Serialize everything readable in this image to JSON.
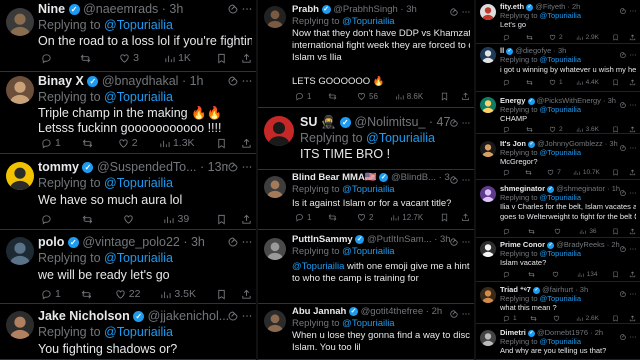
{
  "columns": [
    {
      "tweets": [
        {
          "name": "Nine",
          "handle": "@naeemrads",
          "time": "3h",
          "reply_prefix": "Replying to",
          "reply_to": "@Topuriailia",
          "text": [
            "On the road to a loss lol if you're fighting Islam"
          ],
          "replies": "",
          "reposts": "",
          "likes": "3",
          "views": "1K"
        },
        {
          "name": "Binay X",
          "handle": "@bnaydhakal",
          "time": "1h",
          "reply_prefix": "Replying to",
          "reply_to": "@Topuriailia",
          "text": [
            "Triple champ in the making 🔥🔥",
            "Letsss fuckinn gooooooooooo !!!!"
          ],
          "replies": "1",
          "reposts": "",
          "likes": "2",
          "views": "1.3K"
        },
        {
          "name": "tommy",
          "handle": "@SuspendedTo...",
          "time": "13m",
          "reply_prefix": "Replying to",
          "reply_to": "@Topuriailia",
          "text": [
            "We have so much aura lol"
          ],
          "replies": "",
          "reposts": "",
          "likes": "",
          "views": "39"
        },
        {
          "name": "polo",
          "handle": "@vintage_polo22",
          "time": "3h",
          "reply_prefix": "Replying to",
          "reply_to": "@Topuriailia",
          "text": [
            "we will be ready let's go"
          ],
          "replies": "1",
          "reposts": "",
          "likes": "22",
          "views": "3.5K"
        },
        {
          "name": "Jake Nicholson",
          "handle": "@jjakenichol...",
          "time": "2h",
          "reply_prefix": "Replying to",
          "reply_to": "@Topuriailia",
          "text": [
            "You fighting shadows or?"
          ],
          "replies": "",
          "reposts": "",
          "likes": "",
          "views": ""
        }
      ]
    },
    {
      "tweets": [
        {
          "name": "Prabh",
          "handle": "@PrabhhSingh",
          "time": "3h",
          "reply_prefix": "Replying to",
          "reply_to": "@Topuriailia",
          "text": [
            "Now that they don't have DDP vs Khamzat for",
            "international fight week they are forced to do",
            "Islam vs Ilia",
            "",
            "LETS GOOOOOO 🔥"
          ],
          "replies": "1",
          "reposts": "",
          "likes": "56",
          "views": "8.6K"
        },
        {
          "name": "SU 🥷",
          "handle": "@Nolimitsu_",
          "time": "47m",
          "reply_prefix": "Replying to",
          "reply_to": "@Topuriailia",
          "text": [
            "ITS TIME BRO !"
          ],
          "replies": "",
          "reposts": "",
          "likes": "",
          "views": ""
        },
        {
          "name": "Blind Bear MMA🇺🇸",
          "handle": "@BlindB...",
          "time": "3h",
          "reply_prefix": "Replying to",
          "reply_to": "@Topuriailia",
          "text": [
            "Is it against Islam or for a vacant title?"
          ],
          "replies": "1",
          "reposts": "",
          "likes": "2",
          "views": "12.7K"
        },
        {
          "name": "PuttInSammy",
          "handle": "@PutItInSam...",
          "time": "3h",
          "reply_prefix": "Replying to",
          "reply_to": "@Topuriailia",
          "text": [
            "@Topuriailia with one emoji give me a hint as",
            "to who the camp is training for"
          ],
          "replies": "",
          "reposts": "",
          "likes": "",
          "views": ""
        },
        {
          "name": "Abu Jannah",
          "handle": "@gotit4thefree",
          "time": "2h",
          "reply_prefix": "Replying to",
          "reply_to": "@Topuriailia",
          "text": [
            "When u lose they gonna find a way to discredit",
            "Islam. You too lil"
          ],
          "replies": "",
          "reposts": "",
          "likes": "",
          "views": ""
        }
      ]
    },
    {
      "tweets": [
        {
          "name": "fity.eth",
          "handle": "@Fityeth",
          "time": "2h",
          "reply_prefix": "Replying to",
          "reply_to": "@Topuriailia",
          "text": [
            "Let's go"
          ],
          "replies": "",
          "reposts": "",
          "likes": "2",
          "views": "2.9K"
        },
        {
          "name": "ll",
          "handle": "@diegofye",
          "time": "3h",
          "reply_prefix": "Replying to",
          "reply_to": "@Topuriailia",
          "text": [
            "i got u winning by whatever u wish my heart"
          ],
          "replies": "",
          "reposts": "",
          "likes": "1",
          "views": "4.4K"
        },
        {
          "name": "Energy",
          "handle": "@PicksWithEnergy",
          "time": "3h",
          "reply_prefix": "Replying to",
          "reply_to": "@Topuriailia",
          "text": [
            "CHAMP"
          ],
          "replies": "",
          "reposts": "",
          "likes": "2",
          "views": "3.6K"
        },
        {
          "name": "It's Jon",
          "handle": "@JohnnyGomblezz",
          "time": "3h",
          "reply_prefix": "Replying to",
          "reply_to": "@Topuriailia",
          "text": [
            "McGregor?"
          ],
          "replies": "",
          "reposts": "",
          "likes": "7",
          "views": "10.7K"
        },
        {
          "name": "shmeginator",
          "handle": "@shmeginator",
          "time": "1h",
          "reply_prefix": "Replying to",
          "reply_to": "@Topuriailia",
          "text": [
            "Ilia v Charles for the belt, Islam vacates and",
            "goes to Welterweight to fight for the belt 👀"
          ],
          "replies": "",
          "reposts": "",
          "likes": "",
          "views": "36"
        },
        {
          "name": "Prime Conor",
          "handle": "@BradyReeks",
          "time": "2h",
          "reply_prefix": "Replying to",
          "reply_to": "@Topuriailia",
          "text": [
            "Islam vacate?"
          ],
          "replies": "",
          "reposts": "",
          "likes": "",
          "views": "134"
        },
        {
          "name": "Triad ⁺ᵉ7",
          "handle": "@fairhurt",
          "time": "3h",
          "reply_prefix": "Replying to",
          "reply_to": "@Topuriailia",
          "text": [
            "what this mean ?"
          ],
          "replies": "1",
          "reposts": "",
          "likes": "",
          "views": "2.6K"
        },
        {
          "name": "Dimetri",
          "handle": "@Dornebt1976",
          "time": "2h",
          "reply_prefix": "Replying to",
          "reply_to": "@Topuriailia",
          "text": [
            "And why are you telling us that?"
          ],
          "replies": "",
          "reposts": "",
          "likes": "",
          "views": ""
        }
      ]
    }
  ],
  "colors": {
    "background": "#000000",
    "text": "#e7e9ea",
    "muted": "#71767b",
    "accent": "#1d9bf0",
    "border": "#2f3336"
  },
  "icons": {
    "grok": "grok-icon",
    "more": "more-icon",
    "reply": "reply-icon",
    "repost": "repost-icon",
    "like": "like-icon",
    "views": "views-icon",
    "bookmark": "bookmark-icon",
    "share": "share-icon",
    "verified": "verified-icon"
  }
}
